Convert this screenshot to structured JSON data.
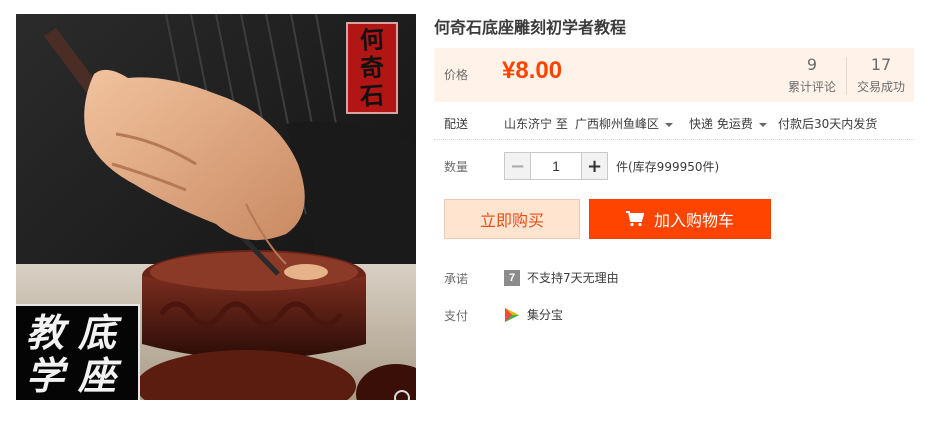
{
  "product": {
    "title": "何奇石底座雕刻初学者教程",
    "image": {
      "seal_top_chars": [
        "何",
        "奇",
        "石"
      ],
      "seal_bottom_chars": [
        "教",
        "底",
        "学",
        "座"
      ]
    }
  },
  "price": {
    "label": "价格",
    "value": "¥8.00",
    "reviews_count": "9",
    "reviews_label": "累计评论",
    "deals_count": "17",
    "deals_label": "交易成功"
  },
  "shipping": {
    "label": "配送",
    "from": "山东济宁 至",
    "to": "广西柳州鱼峰区",
    "method": "快递 免运费",
    "note": "付款后30天内发货"
  },
  "quantity": {
    "label": "数量",
    "value": "1",
    "minus": "−",
    "plus": "+",
    "stock": "件(库存999950件)"
  },
  "actions": {
    "buy_now": "立即购买",
    "add_to_cart": "加入购物车"
  },
  "promise": {
    "label": "承诺",
    "icon_glyph": "7",
    "text": "不支持7天无理由"
  },
  "payment": {
    "label": "支付",
    "text": "集分宝"
  },
  "colors": {
    "accent": "#ff4400",
    "price_bg": "#fff2e8",
    "buy_bg": "#ffe4d0"
  }
}
